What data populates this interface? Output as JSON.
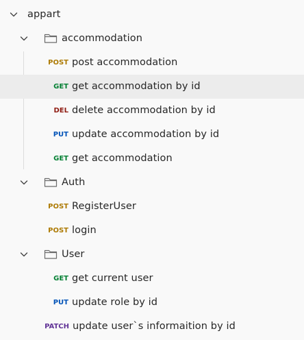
{
  "colors": {
    "POST": "#ad7a03",
    "GET": "#007f31",
    "DEL": "#8e1a10",
    "PUT": "#0053b8",
    "PATCH": "#623497"
  },
  "tree": {
    "root": {
      "label": "appart",
      "icon": "chevron-down-icon"
    },
    "folders": [
      {
        "label": "accommodation",
        "icon": "folder-icon",
        "requests": [
          {
            "method": "POST",
            "label": "post accommodation"
          },
          {
            "method": "GET",
            "label": "get accommodation by id",
            "selected": true
          },
          {
            "method": "DEL",
            "label": "delete accommodation by id"
          },
          {
            "method": "PUT",
            "label": "update accommodation by id"
          },
          {
            "method": "GET",
            "label": "get accommodation"
          }
        ]
      },
      {
        "label": "Auth",
        "icon": "folder-icon",
        "requests": [
          {
            "method": "POST",
            "label": "RegisterUser"
          },
          {
            "method": "POST",
            "label": "login"
          }
        ]
      },
      {
        "label": "User",
        "icon": "folder-icon",
        "requests": [
          {
            "method": "GET",
            "label": "get current user"
          },
          {
            "method": "PUT",
            "label": "update role by id"
          }
        ]
      }
    ],
    "root_requests": [
      {
        "method": "PATCH",
        "label": "update user`s informaition by id"
      }
    ]
  }
}
